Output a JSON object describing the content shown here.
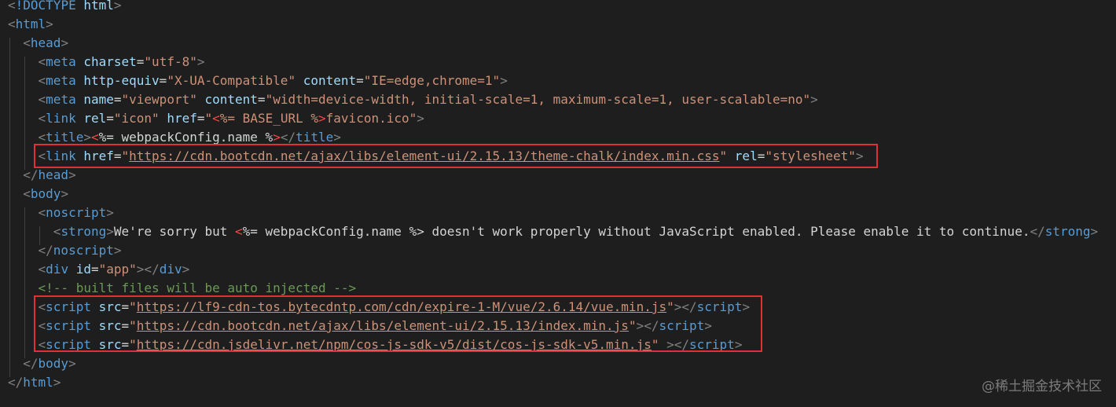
{
  "colors": {
    "background": "#1e1e1e",
    "tag": "#569cd6",
    "attribute": "#9cdcfe",
    "string": "#ce9178",
    "text": "#d4d4d4",
    "punctuation": "#808080",
    "comment": "#6a9955",
    "highlight_box": "#e0313b"
  },
  "code_lines": [
    {
      "tokens": [
        {
          "c": "punc",
          "v": "<"
        },
        {
          "c": "tag",
          "v": "!DOCTYPE"
        },
        {
          "c": "text",
          "v": " "
        },
        {
          "c": "attr",
          "v": "html"
        },
        {
          "c": "punc",
          "v": ">"
        }
      ]
    },
    {
      "tokens": [
        {
          "c": "punc",
          "v": "<"
        },
        {
          "c": "tag",
          "v": "html"
        },
        {
          "c": "punc",
          "v": ">"
        }
      ]
    },
    {
      "tokens": [
        {
          "c": "text",
          "v": "  "
        },
        {
          "c": "punc",
          "v": "<"
        },
        {
          "c": "tag",
          "v": "head"
        },
        {
          "c": "punc",
          "v": ">"
        }
      ]
    },
    {
      "tokens": [
        {
          "c": "text",
          "v": "    "
        },
        {
          "c": "punc",
          "v": "<"
        },
        {
          "c": "tag",
          "v": "meta"
        },
        {
          "c": "text",
          "v": " "
        },
        {
          "c": "attr",
          "v": "charset"
        },
        {
          "c": "text",
          "v": "="
        },
        {
          "c": "str",
          "v": "\"utf-8\""
        },
        {
          "c": "punc",
          "v": ">"
        }
      ]
    },
    {
      "tokens": [
        {
          "c": "text",
          "v": "    "
        },
        {
          "c": "punc",
          "v": "<"
        },
        {
          "c": "tag",
          "v": "meta"
        },
        {
          "c": "text",
          "v": " "
        },
        {
          "c": "attr",
          "v": "http-equiv"
        },
        {
          "c": "text",
          "v": "="
        },
        {
          "c": "str",
          "v": "\"X-UA-Compatible\""
        },
        {
          "c": "text",
          "v": " "
        },
        {
          "c": "attr",
          "v": "content"
        },
        {
          "c": "text",
          "v": "="
        },
        {
          "c": "str",
          "v": "\"IE=edge,chrome=1\""
        },
        {
          "c": "punc",
          "v": ">"
        }
      ]
    },
    {
      "tokens": [
        {
          "c": "text",
          "v": "    "
        },
        {
          "c": "punc",
          "v": "<"
        },
        {
          "c": "tag",
          "v": "meta"
        },
        {
          "c": "text",
          "v": " "
        },
        {
          "c": "attr",
          "v": "name"
        },
        {
          "c": "text",
          "v": "="
        },
        {
          "c": "str",
          "v": "\"viewport\""
        },
        {
          "c": "text",
          "v": " "
        },
        {
          "c": "attr",
          "v": "content"
        },
        {
          "c": "text",
          "v": "="
        },
        {
          "c": "str",
          "v": "\"width=device-width, initial-scale=1, maximum-scale=1, user-scalable=no\""
        },
        {
          "c": "punc",
          "v": ">"
        }
      ]
    },
    {
      "tokens": [
        {
          "c": "text",
          "v": "    "
        },
        {
          "c": "punc",
          "v": "<"
        },
        {
          "c": "tag",
          "v": "link"
        },
        {
          "c": "text",
          "v": " "
        },
        {
          "c": "attr",
          "v": "rel"
        },
        {
          "c": "text",
          "v": "="
        },
        {
          "c": "str",
          "v": "\"icon\""
        },
        {
          "c": "text",
          "v": " "
        },
        {
          "c": "attr",
          "v": "href"
        },
        {
          "c": "text",
          "v": "="
        },
        {
          "c": "str",
          "v": "\""
        },
        {
          "c": "tpl",
          "v": "<"
        },
        {
          "c": "str",
          "v": "%= BASE_URL %"
        },
        {
          "c": "tpl",
          "v": ">"
        },
        {
          "c": "str",
          "v": "favicon.ico\""
        },
        {
          "c": "punc",
          "v": ">"
        }
      ]
    },
    {
      "tokens": [
        {
          "c": "text",
          "v": "    "
        },
        {
          "c": "punc",
          "v": "<"
        },
        {
          "c": "tag",
          "v": "title"
        },
        {
          "c": "punc",
          "v": ">"
        },
        {
          "c": "tpl",
          "v": "<"
        },
        {
          "c": "text",
          "v": "%= webpackConfig.name %"
        },
        {
          "c": "tpl",
          "v": ">"
        },
        {
          "c": "punc",
          "v": "</"
        },
        {
          "c": "tag",
          "v": "title"
        },
        {
          "c": "punc",
          "v": ">"
        }
      ]
    },
    {
      "tokens": [
        {
          "c": "text",
          "v": "    "
        },
        {
          "c": "punc",
          "v": "<"
        },
        {
          "c": "tag",
          "v": "link"
        },
        {
          "c": "text",
          "v": " "
        },
        {
          "c": "attr",
          "v": "href"
        },
        {
          "c": "text",
          "v": "="
        },
        {
          "c": "str",
          "v": "\""
        },
        {
          "c": "url",
          "v": "https://cdn.bootcdn.net/ajax/libs/element-ui/2.15.13/theme-chalk/index.min.css"
        },
        {
          "c": "str",
          "v": "\""
        },
        {
          "c": "text",
          "v": " "
        },
        {
          "c": "attr",
          "v": "rel"
        },
        {
          "c": "text",
          "v": "="
        },
        {
          "c": "str",
          "v": "\"stylesheet\""
        },
        {
          "c": "punc",
          "v": ">"
        }
      ]
    },
    {
      "tokens": [
        {
          "c": "text",
          "v": "  "
        },
        {
          "c": "punc",
          "v": "</"
        },
        {
          "c": "tag",
          "v": "head"
        },
        {
          "c": "punc",
          "v": ">"
        }
      ]
    },
    {
      "tokens": [
        {
          "c": "text",
          "v": "  "
        },
        {
          "c": "punc",
          "v": "<"
        },
        {
          "c": "tag",
          "v": "body"
        },
        {
          "c": "punc",
          "v": ">"
        }
      ]
    },
    {
      "tokens": [
        {
          "c": "text",
          "v": "    "
        },
        {
          "c": "punc",
          "v": "<"
        },
        {
          "c": "tag",
          "v": "noscript"
        },
        {
          "c": "punc",
          "v": ">"
        }
      ]
    },
    {
      "tokens": [
        {
          "c": "text",
          "v": "      "
        },
        {
          "c": "punc",
          "v": "<"
        },
        {
          "c": "tag",
          "v": "strong"
        },
        {
          "c": "punc",
          "v": ">"
        },
        {
          "c": "text",
          "v": "We're sorry but "
        },
        {
          "c": "tpl",
          "v": "<"
        },
        {
          "c": "text",
          "v": "%= webpackConfig.name %> doesn't work properly without JavaScript enabled. Please enable it to continue."
        },
        {
          "c": "punc",
          "v": "</"
        },
        {
          "c": "tag",
          "v": "strong"
        },
        {
          "c": "punc",
          "v": ">"
        }
      ]
    },
    {
      "tokens": [
        {
          "c": "text",
          "v": "    "
        },
        {
          "c": "punc",
          "v": "</"
        },
        {
          "c": "tag",
          "v": "noscript"
        },
        {
          "c": "punc",
          "v": ">"
        }
      ]
    },
    {
      "tokens": [
        {
          "c": "text",
          "v": "    "
        },
        {
          "c": "punc",
          "v": "<"
        },
        {
          "c": "tag",
          "v": "div"
        },
        {
          "c": "text",
          "v": " "
        },
        {
          "c": "attr",
          "v": "id"
        },
        {
          "c": "text",
          "v": "="
        },
        {
          "c": "str",
          "v": "\"app\""
        },
        {
          "c": "punc",
          "v": "></"
        },
        {
          "c": "tag",
          "v": "div"
        },
        {
          "c": "punc",
          "v": ">"
        }
      ]
    },
    {
      "tokens": [
        {
          "c": "text",
          "v": "    "
        },
        {
          "c": "cmt",
          "v": "<!-- built files will be auto injected -->"
        }
      ]
    },
    {
      "tokens": [
        {
          "c": "text",
          "v": "    "
        },
        {
          "c": "punc",
          "v": "<"
        },
        {
          "c": "tag",
          "v": "script"
        },
        {
          "c": "text",
          "v": " "
        },
        {
          "c": "attr",
          "v": "src"
        },
        {
          "c": "text",
          "v": "="
        },
        {
          "c": "str",
          "v": "\""
        },
        {
          "c": "url",
          "v": "https://lf9-cdn-tos.bytecdntp.com/cdn/expire-1-M/vue/2.6.14/vue.min.js"
        },
        {
          "c": "str",
          "v": "\""
        },
        {
          "c": "punc",
          "v": "></"
        },
        {
          "c": "tag",
          "v": "script"
        },
        {
          "c": "punc",
          "v": ">"
        }
      ]
    },
    {
      "tokens": [
        {
          "c": "text",
          "v": "    "
        },
        {
          "c": "punc",
          "v": "<"
        },
        {
          "c": "tag",
          "v": "script"
        },
        {
          "c": "text",
          "v": " "
        },
        {
          "c": "attr",
          "v": "src"
        },
        {
          "c": "text",
          "v": "="
        },
        {
          "c": "str",
          "v": "\""
        },
        {
          "c": "url",
          "v": "https://cdn.bootcdn.net/ajax/libs/element-ui/2.15.13/index.min.js"
        },
        {
          "c": "str",
          "v": "\""
        },
        {
          "c": "punc",
          "v": "></"
        },
        {
          "c": "tag",
          "v": "script"
        },
        {
          "c": "punc",
          "v": ">"
        }
      ]
    },
    {
      "tokens": [
        {
          "c": "text",
          "v": "    "
        },
        {
          "c": "punc",
          "v": "<"
        },
        {
          "c": "tag",
          "v": "script"
        },
        {
          "c": "text",
          "v": " "
        },
        {
          "c": "attr",
          "v": "src"
        },
        {
          "c": "text",
          "v": "="
        },
        {
          "c": "str",
          "v": "\""
        },
        {
          "c": "url",
          "v": "https://cdn.jsdelivr.net/npm/cos-js-sdk-v5/dist/cos-js-sdk-v5.min.js"
        },
        {
          "c": "str",
          "v": "\""
        },
        {
          "c": "text",
          "v": " "
        },
        {
          "c": "punc",
          "v": "></"
        },
        {
          "c": "tag",
          "v": "script"
        },
        {
          "c": "punc",
          "v": ">"
        }
      ]
    },
    {
      "tokens": [
        {
          "c": "text",
          "v": "  "
        },
        {
          "c": "punc",
          "v": "</"
        },
        {
          "c": "tag",
          "v": "body"
        },
        {
          "c": "punc",
          "v": ">"
        }
      ]
    },
    {
      "tokens": [
        {
          "c": "punc",
          "v": "</"
        },
        {
          "c": "tag",
          "v": "html"
        },
        {
          "c": "punc",
          "v": ">"
        }
      ]
    }
  ],
  "watermark": "@稀土掘金技术社区"
}
